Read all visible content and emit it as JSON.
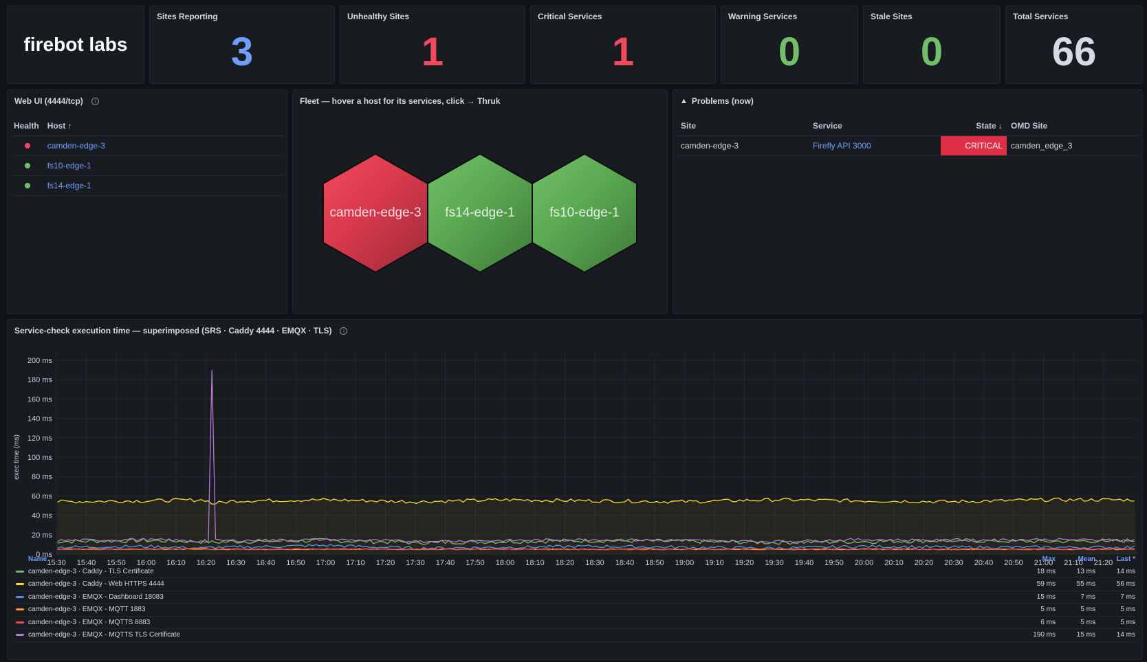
{
  "logo": {
    "text": "firebot labs"
  },
  "stats": [
    {
      "title": "Sites Reporting",
      "value": "3",
      "color": "#6e9fff"
    },
    {
      "title": "Unhealthy Sites",
      "value": "1",
      "color": "#f2495c"
    },
    {
      "title": "Critical Services",
      "value": "1",
      "color": "#f2495c"
    },
    {
      "title": "Warning Services",
      "value": "0",
      "color": "#73bf69"
    },
    {
      "title": "Stale Sites",
      "value": "0",
      "color": "#73bf69"
    },
    {
      "title": "Total Services",
      "value": "66",
      "color": "#d8d9e6"
    }
  ],
  "webui": {
    "title": "Web UI (4444/tcp)",
    "col_health": "Health",
    "col_host": "Host ↑",
    "rows": [
      {
        "host": "camden-edge-3",
        "status_color": "#f2495c"
      },
      {
        "host": "fs10-edge-1",
        "status_color": "#73bf69"
      },
      {
        "host": "fs14-edge-1",
        "status_color": "#73bf69"
      }
    ]
  },
  "fleet": {
    "title": "Fleet — hover a host for its services, click → Thruk",
    "hexes": [
      {
        "label": "camden-edge-3",
        "status": "critical"
      },
      {
        "label": "fs14-edge-1",
        "status": "ok"
      },
      {
        "label": "fs10-edge-1",
        "status": "ok"
      }
    ]
  },
  "problems": {
    "title": "Problems (now)",
    "icon": "warning-triangle-icon",
    "columns": [
      "Site",
      "Service",
      "State ↓",
      "OMD Site"
    ],
    "rows": [
      {
        "site": "camden-edge-3",
        "service": "Firefly API 3000",
        "state": "CRITICAL",
        "omd_site": "camden_edge_3"
      }
    ]
  },
  "timeseries": {
    "title": "Service-check execution time — superimposed (SRS · Caddy 4444 · EMQX · TLS)",
    "legend_header": {
      "name": "Name",
      "max": "Max",
      "mean": "Mean",
      "last": "Last *"
    },
    "legend": [
      {
        "name": "camden-edge-3 · Caddy - TLS Certificate",
        "color": "#73bf69",
        "max": "18 ms",
        "mean": "13 ms",
        "last": "14 ms"
      },
      {
        "name": "camden-edge-3 · Caddy - Web HTTPS 4444",
        "color": "#fade2a",
        "max": "59 ms",
        "mean": "55 ms",
        "last": "56 ms"
      },
      {
        "name": "camden-edge-3 · EMQX - Dashboard 18083",
        "color": "#5794f2",
        "max": "15 ms",
        "mean": "7 ms",
        "last": "7 ms"
      },
      {
        "name": "camden-edge-3 · EMQX - MQTT 1883",
        "color": "#ff9830",
        "max": "5 ms",
        "mean": "5 ms",
        "last": "5 ms"
      },
      {
        "name": "camden-edge-3 · EMQX - MQTTS 8883",
        "color": "#f2495c",
        "max": "6 ms",
        "mean": "5 ms",
        "last": "5 ms"
      },
      {
        "name": "camden-edge-3 · EMQX - MQTTS TLS Certificate",
        "color": "#b877d9",
        "max": "190 ms",
        "mean": "15 ms",
        "last": "14 ms"
      }
    ]
  },
  "chart_data": {
    "type": "line",
    "ylabel": "exec time (ms)",
    "ylim": [
      0,
      200
    ],
    "yticks": [
      "0 ms",
      "20 ms",
      "40 ms",
      "60 ms",
      "80 ms",
      "100 ms",
      "120 ms",
      "140 ms",
      "160 ms",
      "180 ms",
      "200 ms"
    ],
    "xticks": [
      "15:30",
      "15:40",
      "15:50",
      "16:00",
      "16:10",
      "16:20",
      "16:30",
      "16:40",
      "16:50",
      "17:00",
      "17:10",
      "17:20",
      "17:30",
      "17:40",
      "17:50",
      "18:00",
      "18:10",
      "18:20",
      "18:30",
      "18:40",
      "18:50",
      "19:00",
      "19:10",
      "19:20",
      "19:30",
      "19:40",
      "19:50",
      "20:00",
      "20:10",
      "20:20",
      "20:30",
      "20:40",
      "20:50",
      "21:00",
      "21:10",
      "21:20"
    ],
    "x": [
      "15:30",
      "16:00",
      "16:20",
      "16:22",
      "16:30",
      "17:00",
      "17:30",
      "18:00",
      "18:30",
      "19:00",
      "19:30",
      "20:00",
      "20:30",
      "21:00",
      "21:30"
    ],
    "series": [
      {
        "name": "camden-edge-3 · Caddy - TLS Certificate",
        "values": [
          13,
          14,
          13,
          12,
          13,
          14,
          12,
          13,
          14,
          13,
          12,
          13,
          14,
          13,
          14
        ]
      },
      {
        "name": "camden-edge-3 · Caddy - Web HTTPS 4444",
        "values": [
          54,
          55,
          56,
          52,
          55,
          56,
          54,
          56,
          55,
          54,
          56,
          55,
          54,
          56,
          56
        ]
      },
      {
        "name": "camden-edge-3 · EMQX - Dashboard 18083",
        "values": [
          7,
          8,
          6,
          7,
          7,
          9,
          6,
          7,
          8,
          7,
          6,
          8,
          7,
          7,
          7
        ]
      },
      {
        "name": "camden-edge-3 · EMQX - MQTT 1883",
        "values": [
          5,
          5,
          5,
          5,
          5,
          5,
          5,
          5,
          5,
          5,
          5,
          5,
          5,
          5,
          5
        ]
      },
      {
        "name": "camden-edge-3 · EMQX - MQTTS 8883",
        "values": [
          5,
          5,
          6,
          5,
          5,
          5,
          5,
          5,
          5,
          5,
          5,
          5,
          5,
          5,
          5
        ]
      },
      {
        "name": "camden-edge-3 · EMQX - MQTTS TLS Certificate",
        "values": [
          14,
          15,
          13,
          190,
          14,
          15,
          13,
          14,
          15,
          14,
          13,
          15,
          14,
          15,
          14
        ]
      }
    ]
  }
}
